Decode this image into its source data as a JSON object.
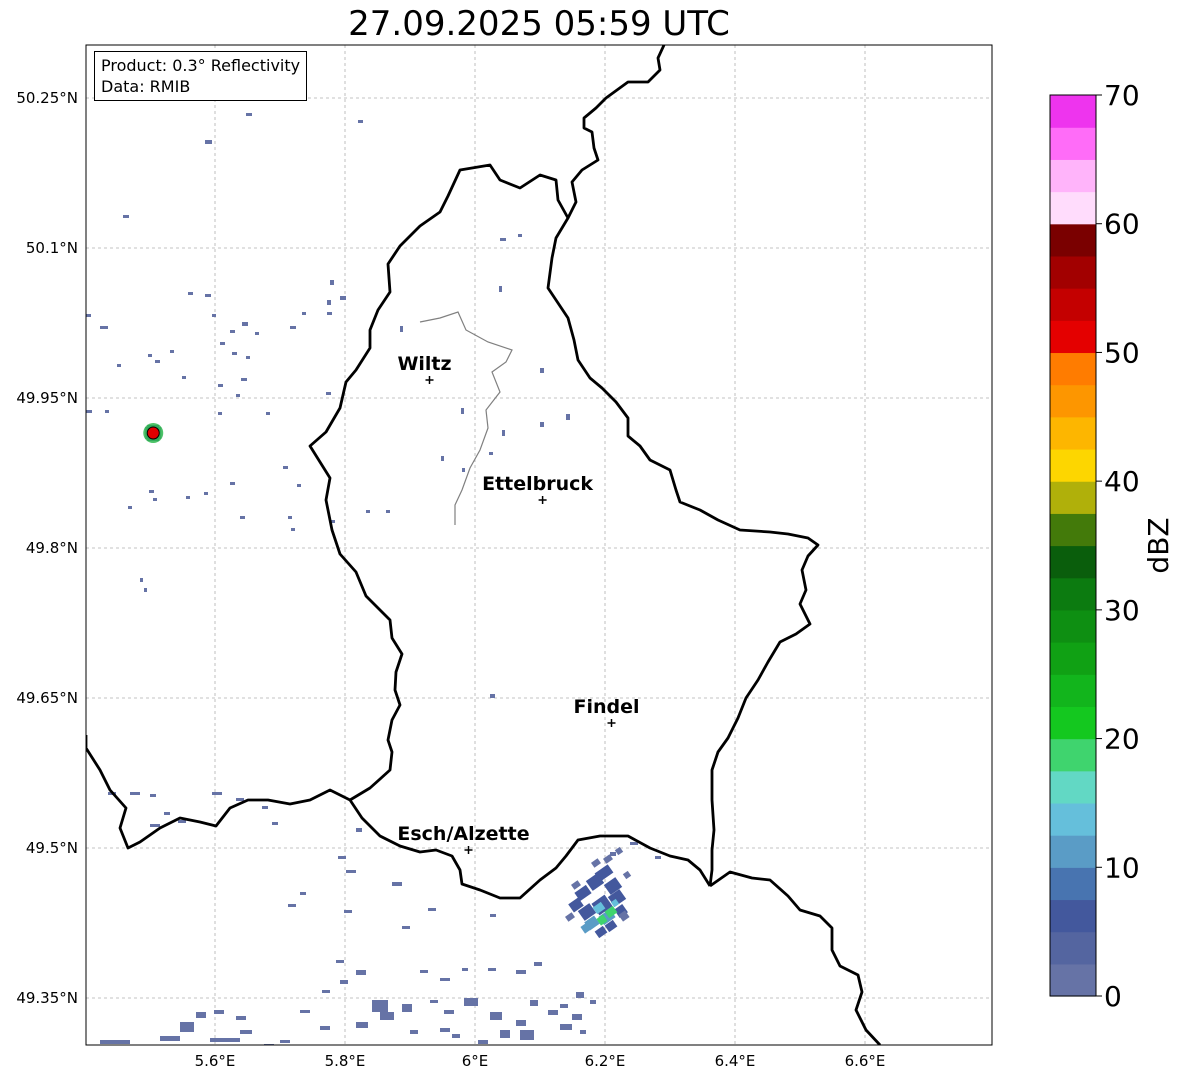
{
  "title": "27.09.2025 05:59 UTC",
  "info_box": {
    "product": "Product: 0.3° Reflectivity",
    "data": "Data: RMIB"
  },
  "lon_ticks": [
    {
      "value": 5.6,
      "label": "5.6°E"
    },
    {
      "value": 5.8,
      "label": "5.8°E"
    },
    {
      "value": 6.0,
      "label": "6°E"
    },
    {
      "value": 6.2,
      "label": "6.2°E"
    },
    {
      "value": 6.4,
      "label": "6.4°E"
    },
    {
      "value": 6.6,
      "label": "6.6°E"
    }
  ],
  "lat_ticks": [
    {
      "value": 50.25,
      "label": "50.25°N"
    },
    {
      "value": 50.1,
      "label": "50.1°N"
    },
    {
      "value": 49.95,
      "label": "49.95°N"
    },
    {
      "value": 49.8,
      "label": "49.8°N"
    },
    {
      "value": 49.65,
      "label": "49.65°N"
    },
    {
      "value": 49.5,
      "label": "49.5°N"
    },
    {
      "value": 49.35,
      "label": "49.35°N"
    }
  ],
  "cities": [
    {
      "name": "Wiltz",
      "lon": 5.93,
      "lat": 49.968
    },
    {
      "name": "Ettelbruck",
      "lon": 6.104,
      "lat": 49.848
    },
    {
      "name": "Findel",
      "lon": 6.21,
      "lat": 49.625
    },
    {
      "name": "Esch/Alzette",
      "lon": 5.99,
      "lat": 49.498
    }
  ],
  "radar_site": {
    "lon": 5.505,
    "lat": 49.915,
    "color": "#e00000"
  },
  "colorbar": {
    "label": "dBZ",
    "min": 0,
    "max": 70,
    "step": 2.5,
    "ticks": [
      "0",
      "10",
      "20",
      "30",
      "40",
      "50",
      "60",
      "70"
    ],
    "colors": [
      "#6673a6",
      "#5465a0",
      "#43589d",
      "#4874b0",
      "#5a9cc6",
      "#65bfdb",
      "#62d8c4",
      "#3fd46e",
      "#14c81f",
      "#12b51c",
      "#10a114",
      "#0e8f12",
      "#0c7b10",
      "#0a5e0c",
      "#437a0a",
      "#b0b00a",
      "#fdd600",
      "#fdb600",
      "#fd9600",
      "#ff7c00",
      "#e40000",
      "#c40000",
      "#a20000",
      "#7a0000",
      "#ffdcfc",
      "#ffb4fa",
      "#ff6cf8",
      "#ee34ee"
    ]
  }
}
